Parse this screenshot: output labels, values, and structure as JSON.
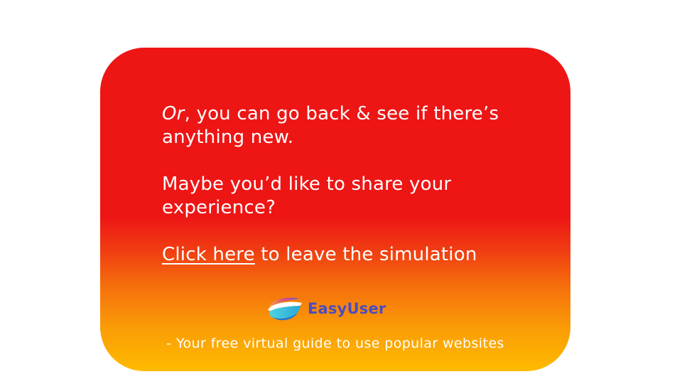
{
  "message": {
    "line1_emphasis": "Or",
    "line1_rest": ", you can go back & see if there’s anything new.",
    "line2": "Maybe you’d like to share your experience?",
    "line3_link": "Click here",
    "line3_rest": " to leave the simulation"
  },
  "brand": {
    "name": "EasyUser",
    "logo_icon": "easyuser-logo-icon",
    "name_color": "#4a4cc2"
  },
  "tagline": "- Your free virtual guide to use popular websites",
  "colors": {
    "card_top": "#ee1515",
    "card_bottom": "#ffbb00",
    "text": "#ffffff"
  }
}
